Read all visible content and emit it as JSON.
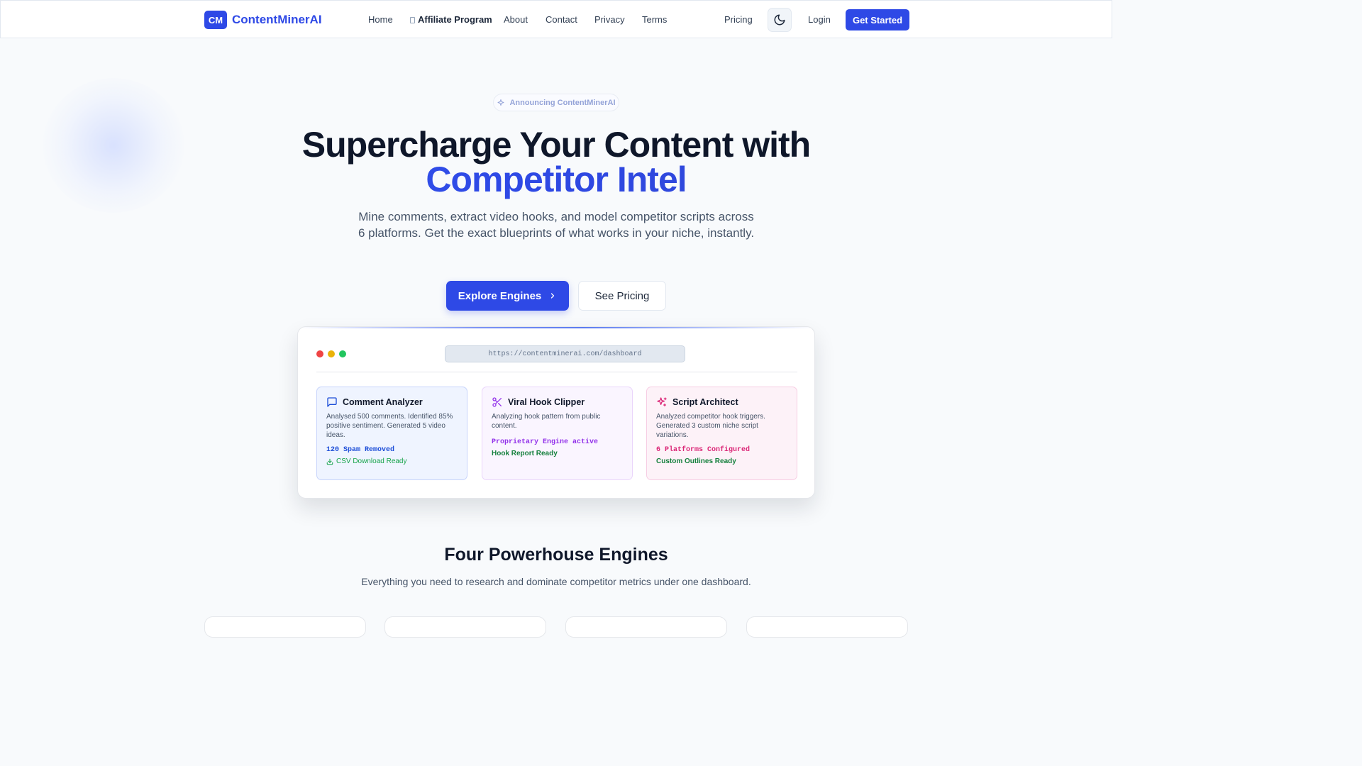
{
  "nav": {
    "logo_mark": "CM",
    "brand": "ContentMinerAI",
    "links": [
      "Home",
      "Affiliate Program",
      "About",
      "Contact",
      "Privacy",
      "Terms"
    ],
    "pricing": "Pricing",
    "theme_icon": "moon-icon",
    "login": "Login",
    "cta": "Get Started"
  },
  "hero": {
    "badge": "Announcing ContentMinerAI",
    "title_line1": "Supercharge Your Content with",
    "title_line2": "Competitor Intel",
    "subtitle": "Mine comments, extract video hooks, and model competitor scripts across 6 platforms. Get the exact blueprints of what works in your niche, instantly.",
    "primary_button": "Explore Engines",
    "secondary_button": "See Pricing"
  },
  "dashboard": {
    "url": "https://contentminerai.com/dashboard",
    "window_dots": [
      "#ef4444",
      "#eab308",
      "#22c55e"
    ],
    "cards": [
      {
        "title": "Comment Analyzer",
        "icon": "message-square-icon",
        "desc": "Analysed 500 comments. Identified 85% positive sentiment. Generated 5 video ideas.",
        "stat": "120 Spam Removed",
        "status": "CSV Download Ready",
        "accent": "#1d4ed8"
      },
      {
        "title": "Viral Hook Clipper",
        "icon": "scissors-icon",
        "desc": "Analyzing hook pattern from public content.",
        "stat": "Proprietary Engine active",
        "status": "Hook Report Ready",
        "accent": "#9333ea"
      },
      {
        "title": "Script Architect",
        "icon": "sparkles-icon",
        "desc": "Analyzed competitor hook triggers. Generated 3 custom niche script variations.",
        "stat": "6 Platforms Configured",
        "status": "Custom Outlines Ready",
        "accent": "#db2777"
      }
    ]
  },
  "engines": {
    "title": "Four Powerhouse Engines",
    "subtitle": "Everything you need to research and dominate competitor metrics under one dashboard."
  },
  "colors": {
    "brand": "#2e49e6",
    "success": "#15803d"
  }
}
